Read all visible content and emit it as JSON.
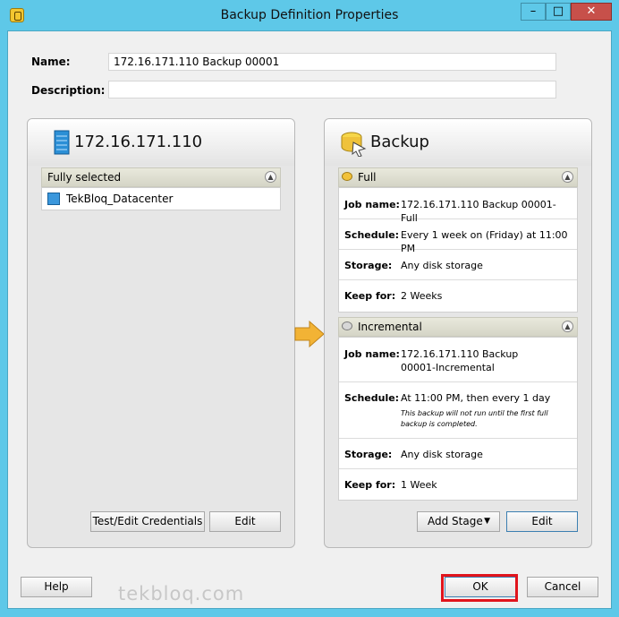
{
  "window": {
    "title": "Backup Definition Properties"
  },
  "form": {
    "name_label": "Name:",
    "name_value": "172.16.171.110 Backup 00001",
    "description_label": "Description:",
    "description_value": ""
  },
  "source_panel": {
    "title": "172.16.171.110",
    "selection_header": "Fully selected",
    "items": [
      "TekBloq_Datacenter"
    ],
    "test_credentials_button": "Test/Edit Credentials",
    "edit_button": "Edit"
  },
  "backup_panel": {
    "title": "Backup",
    "full": {
      "header": "Full",
      "job_name_label": "Job name:",
      "job_name": "172.16.171.110 Backup 00001-Full",
      "schedule_label": "Schedule:",
      "schedule": "Every 1 week on (Friday) at 11:00 PM",
      "storage_label": "Storage:",
      "storage": "Any disk storage",
      "keep_label": "Keep for:",
      "keep": "2 Weeks"
    },
    "incremental": {
      "header": "Incremental",
      "job_name_label": "Job name:",
      "job_name": "172.16.171.110 Backup 00001-Incremental",
      "schedule_label": "Schedule:",
      "schedule": "At 11:00 PM, then every 1 day",
      "schedule_note": "This backup will not run until the first full backup is completed.",
      "storage_label": "Storage:",
      "storage": "Any disk storage",
      "keep_label": "Keep for:",
      "keep": "1 Week"
    },
    "add_stage_button": "Add Stage",
    "edit_button": "Edit"
  },
  "footer": {
    "help_button": "Help",
    "watermark": "tekbloq.com",
    "ok_button": "OK",
    "cancel_button": "Cancel"
  },
  "colors": {
    "frame": "#5ec8e8",
    "highlight": "#e1141c",
    "arrow": "#f2b335"
  }
}
